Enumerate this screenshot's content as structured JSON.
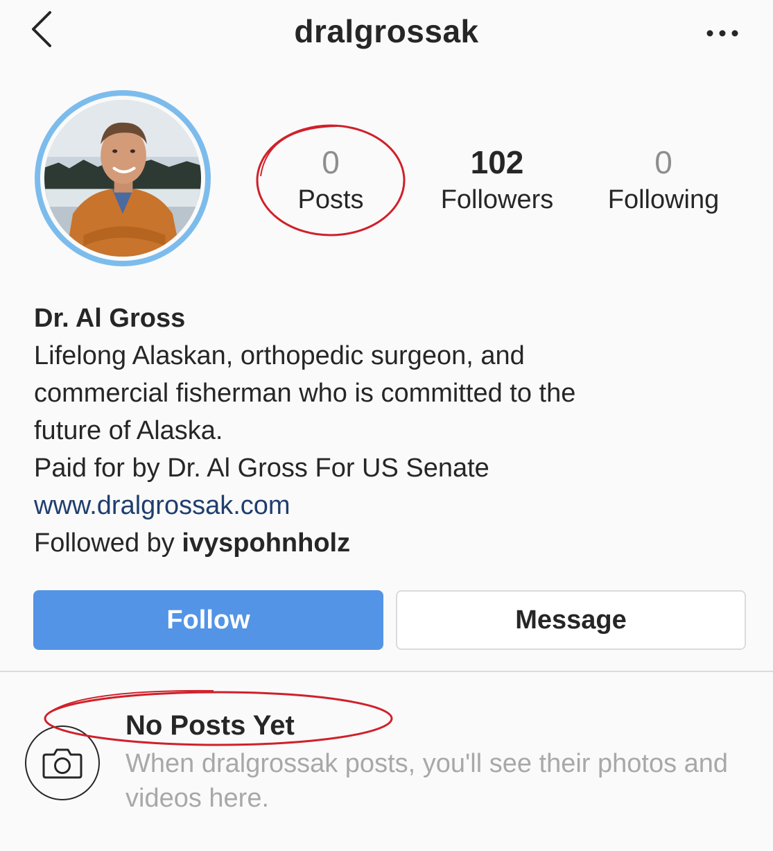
{
  "header": {
    "title": "dralgrossak",
    "back_icon": "chevron-left-icon",
    "more_icon": "more-horizontal-icon"
  },
  "profile": {
    "avatar_ring_color": "#7cbcec",
    "stats": {
      "posts": {
        "count": "0",
        "label": "Posts"
      },
      "followers": {
        "count": "102",
        "label": "Followers"
      },
      "following": {
        "count": "0",
        "label": "Following"
      }
    },
    "name": "Dr. Al Gross",
    "bio_lines": [
      "Lifelong Alaskan, orthopedic surgeon, and",
      "commercial fisherman who is committed to the",
      "future of Alaska.",
      "Paid for by Dr. Al Gross For US Senate"
    ],
    "website": "www.dralgrossak.com",
    "followed_by_prefix": "Followed by ",
    "followed_by_user": "ivyspohnholz"
  },
  "actions": {
    "follow_label": "Follow",
    "message_label": "Message",
    "follow_color": "#5394e6"
  },
  "empty_state": {
    "icon": "camera-icon",
    "title": "No Posts Yet",
    "body": "When dralgrossak posts, you'll see their photos and videos here."
  },
  "annotations": {
    "color": "#d0202a"
  }
}
